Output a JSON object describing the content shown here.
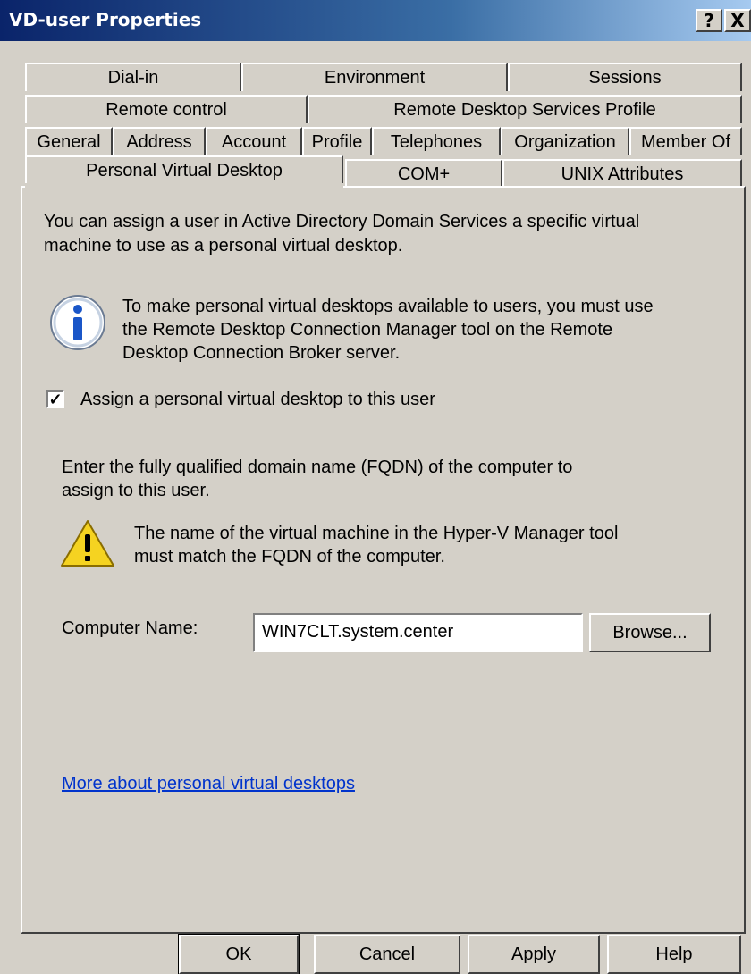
{
  "window": {
    "title": "VD-user Properties",
    "help_glyph": "?",
    "close_glyph": "X"
  },
  "tabs": {
    "row1": [
      "Dial-in",
      "Environment",
      "Sessions"
    ],
    "row2": [
      "Remote control",
      "Remote Desktop Services Profile"
    ],
    "row3": [
      "General",
      "Address",
      "Account",
      "Profile",
      "Telephones",
      "Organization",
      "Member Of"
    ],
    "row4": [
      "Personal Virtual Desktop",
      "COM+",
      "UNIX Attributes"
    ],
    "active": "Personal Virtual Desktop"
  },
  "content": {
    "intro_line1": "You can assign a user in Active Directory Domain Services a specific virtual",
    "intro_line2": "machine to use as a personal virtual desktop.",
    "info_line1": "To make personal virtual desktops available to users, you must use",
    "info_line2": "the Remote Desktop Connection Manager tool on the Remote",
    "info_line3": "Desktop Connection Broker server.",
    "checkbox_label": "Assign a personal virtual desktop to this user",
    "checkbox_checked": true,
    "checkbox_glyph": "✓",
    "fqdn_line1": "Enter the fully qualified domain name (FQDN) of the computer to",
    "fqdn_line2": "assign to this user.",
    "warn_line1": "The name of the virtual machine in the Hyper-V Manager tool",
    "warn_line2": "must match the FQDN of the computer.",
    "computer_name_label": "Computer Name:",
    "computer_name_value": "WIN7CLT.system.center",
    "browse_label": "Browse...",
    "link_text": "More about personal virtual desktops"
  },
  "footer": {
    "ok": "OK",
    "cancel": "Cancel",
    "apply": "Apply",
    "help": "Help"
  },
  "colors": {
    "face": "#d4d0c8",
    "title_start": "#0a246a",
    "title_end": "#a6caf0",
    "link": "#0033cc"
  }
}
